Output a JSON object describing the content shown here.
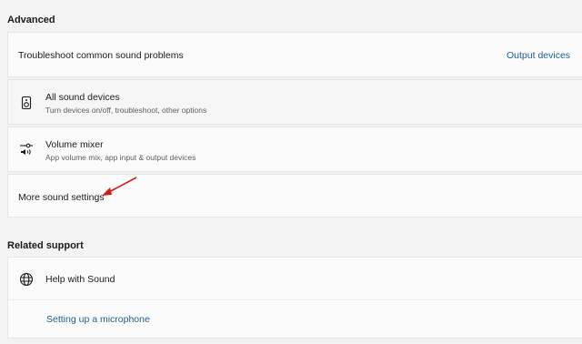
{
  "sections": {
    "advanced": "Advanced",
    "related": "Related support"
  },
  "troubleshoot": {
    "label": "Troubleshoot common sound problems",
    "link": "Output devices"
  },
  "all_devices": {
    "title": "All sound devices",
    "subtitle": "Turn devices on/off, troubleshoot, other options"
  },
  "volume_mixer": {
    "title": "Volume mixer",
    "subtitle": "App volume mix, app input & output devices"
  },
  "more_sound": {
    "label": "More sound settings"
  },
  "help": {
    "title": "Help with Sound",
    "link": "Setting up a microphone"
  },
  "colors": {
    "accent_link": "#1f5c8f",
    "annotation_arrow": "#d11a1a"
  },
  "icons": [
    "speaker-device-icon",
    "volume-mixer-icon",
    "globe-icon",
    "annotation-arrow"
  ]
}
